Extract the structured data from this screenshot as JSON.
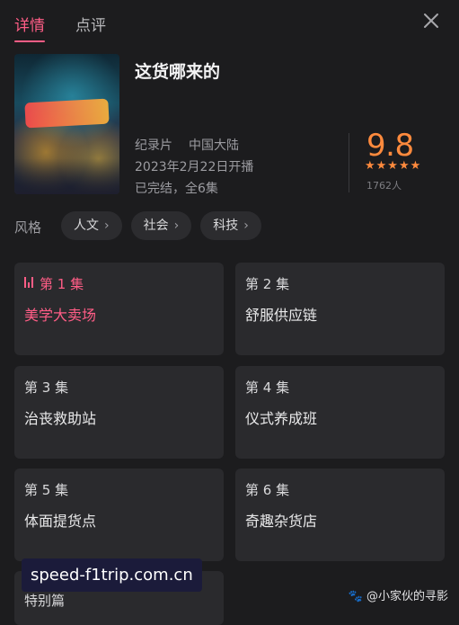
{
  "tabs": [
    {
      "label": "详情",
      "active": true
    },
    {
      "label": "点评",
      "active": false
    }
  ],
  "icons": {
    "close": "close-icon",
    "playing": "playing-bars-icon",
    "chevron": "chevron-right-icon"
  },
  "show": {
    "title": "这货哪来的",
    "genre": "纪录片",
    "region": "中国大陆",
    "release": "2023年2月22日开播",
    "episodes_status": "已完结，全6集",
    "rating": "9.8",
    "stars": "★★★★★",
    "rating_count": "1762人"
  },
  "style": {
    "label": "风格",
    "tags": [
      "人文",
      "社会",
      "科技"
    ]
  },
  "episodes": [
    {
      "num": "第 1 集",
      "name": "美学大卖场",
      "active": true
    },
    {
      "num": "第 2 集",
      "name": "舒服供应链"
    },
    {
      "num": "第 3 集",
      "name": "治丧救助站"
    },
    {
      "num": "第 4 集",
      "name": "仪式养成班"
    },
    {
      "num": "第 5 集",
      "name": "体面提货点"
    },
    {
      "num": "第 6 集",
      "name": "奇趣杂货店"
    },
    {
      "num": "特别篇"
    }
  ],
  "watermark": "speed-f1trip.com.cn",
  "credit": "@小家伙的寻影",
  "colors": {
    "accent": "#ff5d86",
    "rating": "#ff8a3d",
    "background": "#1c1c1e",
    "card": "#2a2a2d"
  }
}
